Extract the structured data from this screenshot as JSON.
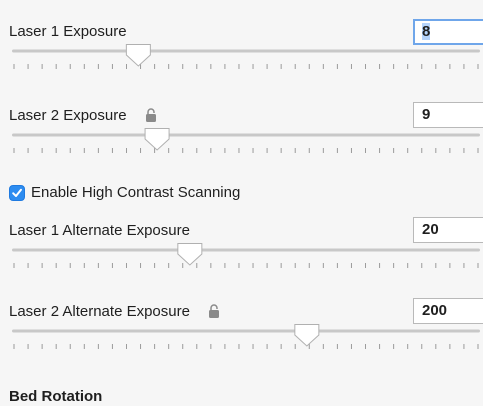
{
  "settings": [
    {
      "label": "Laser 1 Exposure",
      "value": "8",
      "locked": false,
      "focused": true,
      "slider_fraction": 0.27
    },
    {
      "label": "Laser 2 Exposure",
      "value": "9",
      "locked": true,
      "focused": false,
      "slider_fraction": 0.31
    },
    {
      "label": "Laser 1 Alternate Exposure",
      "value": "20",
      "locked": false,
      "focused": false,
      "slider_fraction": 0.38
    },
    {
      "label": "Laser 2 Alternate Exposure",
      "value": "200",
      "locked": true,
      "focused": false,
      "slider_fraction": 0.63
    }
  ],
  "high_contrast": {
    "label": "Enable High Contrast Scanning",
    "checked": true
  },
  "section_title": "Bed Rotation",
  "colors": {
    "accent": "#2d8cf0",
    "focus_ring": "#6fa6ea",
    "track": "#c8c8c8"
  },
  "icons": {
    "lock": "lock-icon",
    "checkbox": "checkmark-icon",
    "slider_thumb": "slider-thumb-icon"
  }
}
